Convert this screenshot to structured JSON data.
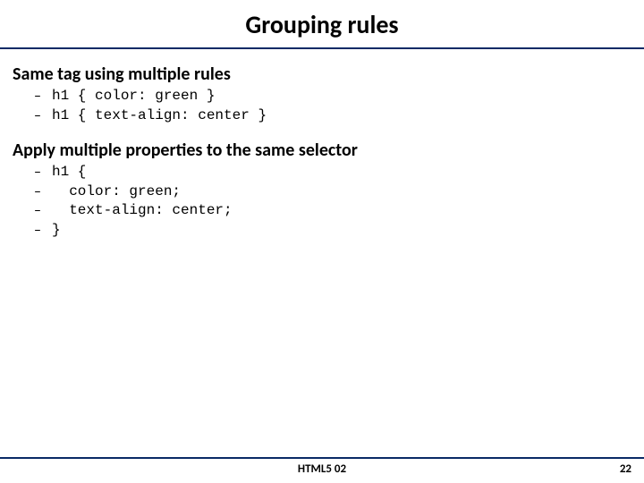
{
  "title": "Grouping rules",
  "sections": [
    {
      "heading": "Same tag using multiple rules",
      "lines": [
        "h1 { color: green }",
        "h1 { text-align: center }"
      ]
    },
    {
      "heading": "Apply multiple properties to the same selector",
      "lines": [
        "h1 {",
        "  color: green;",
        "  text-align: center;",
        "}"
      ]
    }
  ],
  "footer": {
    "center": "HTML5 02",
    "right": "22"
  }
}
